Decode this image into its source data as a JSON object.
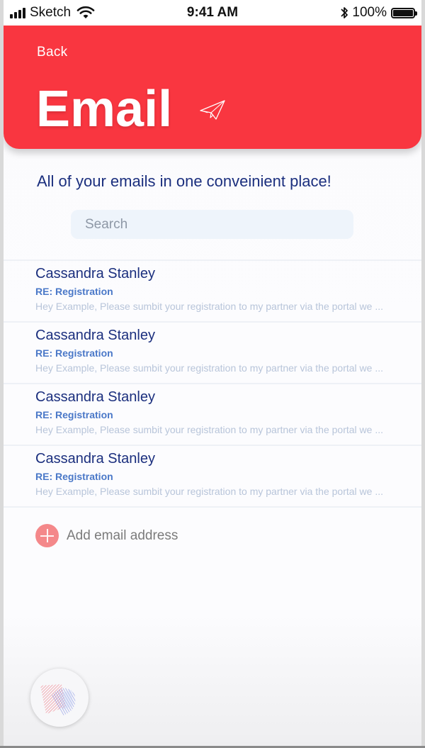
{
  "status_bar": {
    "carrier": "Sketch",
    "time": "9:41 AM",
    "battery": "100%"
  },
  "header": {
    "back_label": "Back",
    "title": "Email",
    "title_icon": "paper-plane-icon",
    "accent_color": "#f93640"
  },
  "subtitle": "All of your emails in one conveinient place!",
  "search": {
    "placeholder": "Search",
    "value": ""
  },
  "emails": [
    {
      "sender": "Cassandra Stanley",
      "subject": "RE: Registration",
      "preview": "Hey Example, Please sumbit your registration to my partner via the portal we ..."
    },
    {
      "sender": "Cassandra Stanley",
      "subject": "RE: Registration",
      "preview": "Hey Example, Please sumbit your registration to my partner via the portal we ..."
    },
    {
      "sender": "Cassandra Stanley",
      "subject": "RE: Registration",
      "preview": "Hey Example, Please sumbit your registration to my partner via the portal we ..."
    },
    {
      "sender": "Cassandra Stanley",
      "subject": "RE: Registration",
      "preview": "Hey Example, Please sumbit your registration to my partner via the portal we ..."
    }
  ],
  "add_email": {
    "label": "Add email address",
    "icon": "plus-circle-icon"
  },
  "fab": {
    "icon": "siri-orb-icon"
  },
  "colors": {
    "navy": "#1b2f7e",
    "subject_blue": "#4a78c8",
    "preview_gray": "#b8c5da"
  }
}
